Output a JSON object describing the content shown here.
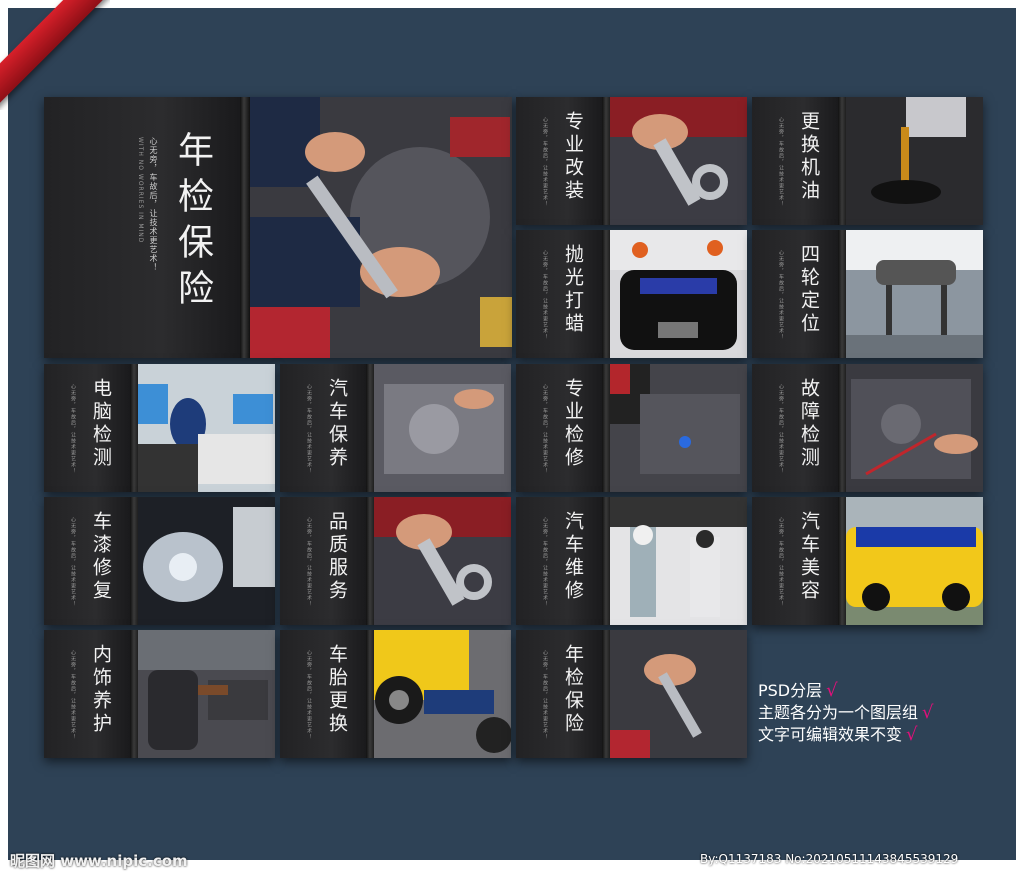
{
  "main": {
    "title": "年检保险",
    "subtitle": "心无旁，车故后，让技术更艺术！",
    "subtitle_en": "WITH NO WORRIES IN MIND"
  },
  "panels": [
    {
      "title": "专业改装",
      "photo": "wrench-hand"
    },
    {
      "title": "更换机油",
      "photo": "oil-pour"
    },
    {
      "title": "抛光打蜡",
      "photo": "black-car-front"
    },
    {
      "title": "四轮定位",
      "photo": "workshop-lift"
    },
    {
      "title": "电脑检测",
      "photo": "computer-diagnostics"
    },
    {
      "title": "汽车保养",
      "photo": "engine-wipe"
    },
    {
      "title": "专业检修",
      "photo": "engine-repair"
    },
    {
      "title": "故障检测",
      "photo": "engine-test"
    },
    {
      "title": "车漆修复",
      "photo": "headlight"
    },
    {
      "title": "品质服务",
      "photo": "wrench-hand"
    },
    {
      "title": "汽车维修",
      "photo": "mechanics-under-car"
    },
    {
      "title": "汽车美容",
      "photo": "race-car"
    },
    {
      "title": "内饰养护",
      "photo": "car-interior"
    },
    {
      "title": "车胎更换",
      "photo": "tire-change"
    },
    {
      "title": "年检保险",
      "photo": "engine-wrench"
    }
  ],
  "info": {
    "line1": "PSD分层",
    "line2": "主题各分为一个图层组",
    "line3": "文字可编辑效果不变",
    "check": "√"
  },
  "watermark": {
    "site": "昵图网 www.nipic.com",
    "id": "By:Q1137183 No:20210511143845539129"
  },
  "colors": {
    "background": "#2e4256",
    "panel": "#1c1c1e",
    "check": "#e0107a",
    "ribbon": "#d8202a"
  }
}
